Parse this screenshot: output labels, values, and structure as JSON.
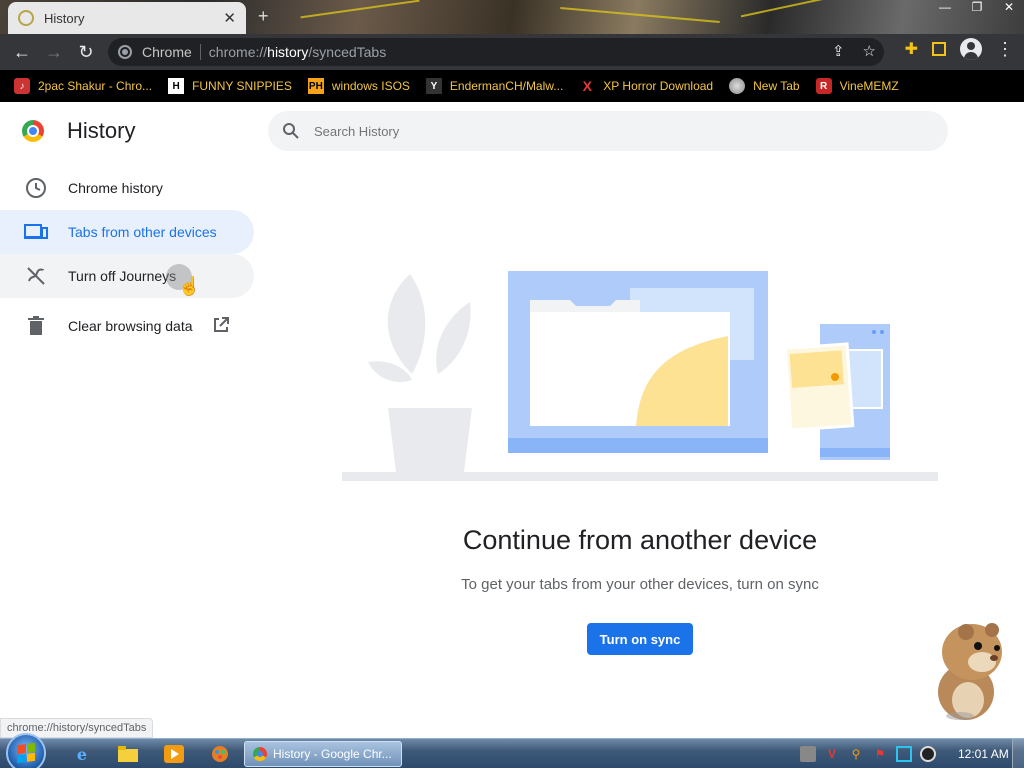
{
  "browser": {
    "tab_title": "History",
    "toolbar": {
      "back": "←",
      "forward": "→",
      "reload": "↻",
      "omnibox_label": "Chrome",
      "url_prefix": "chrome://",
      "url_host": "history",
      "url_path": "/syncedTabs"
    },
    "bookmarks": [
      {
        "label": "2pac Shakur - Chro...",
        "icon": "music-icon"
      },
      {
        "label": "FUNNY SNIPPIES",
        "icon_text": "H"
      },
      {
        "label": "windows ISOS",
        "icon_text": "PH"
      },
      {
        "label": "EndermanCH/Malw...",
        "icon_text": "Y"
      },
      {
        "label": "XP Horror Download",
        "icon_text": "X"
      },
      {
        "label": "New Tab",
        "icon": "globe-icon"
      },
      {
        "label": "VineMEMZ",
        "icon_text": "R"
      }
    ]
  },
  "history_page": {
    "title": "History",
    "search_placeholder": "Search History",
    "menu": {
      "chrome_history": "Chrome history",
      "tabs_other_devices": "Tabs from other devices",
      "turn_off_journeys": "Turn off Journeys",
      "clear_browsing_data": "Clear browsing data"
    },
    "headline": "Continue from another device",
    "subline": "To get your tabs from your other devices, turn on sync",
    "sync_button": "Turn on sync"
  },
  "status_url": "chrome://history/syncedTabs",
  "taskbar": {
    "active_window": "History - Google Chr...",
    "clock": "12:01 AM"
  },
  "colors": {
    "accent": "#1a73e8",
    "selected_bg": "#e8f0fe",
    "bookmark_text": "#f4c542"
  }
}
